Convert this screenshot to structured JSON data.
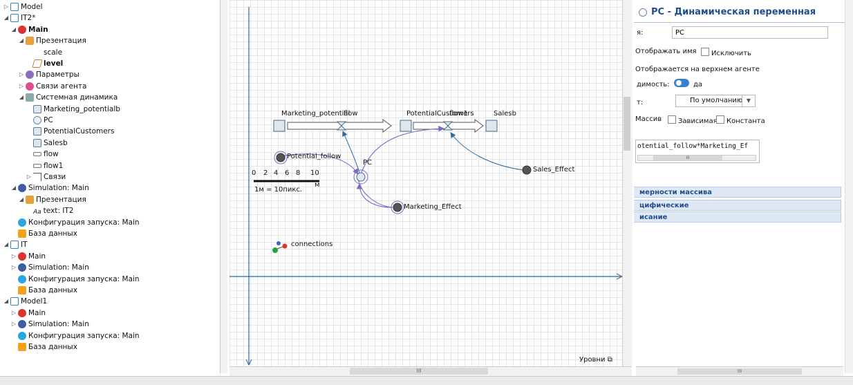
{
  "tree": [
    {
      "label": "Model",
      "icon": "model-icon",
      "level": 0,
      "twisty": "▷",
      "bold": false
    },
    {
      "label": "IT2*",
      "icon": "model-icon",
      "level": 0,
      "twisty": "◢",
      "bold": false
    },
    {
      "label": "Main",
      "icon": "agent-icon",
      "level": 1,
      "twisty": "◢",
      "bold": true
    },
    {
      "label": "Презентация",
      "icon": "presentation-icon",
      "level": 2,
      "twisty": "◢",
      "bold": false
    },
    {
      "label": "scale",
      "icon": "scale-icon",
      "level": 3,
      "twisty": "",
      "bold": false
    },
    {
      "label": "level",
      "icon": "level-icon",
      "level": 3,
      "twisty": "",
      "bold": true
    },
    {
      "label": "Параметры",
      "icon": "parameters-icon",
      "level": 2,
      "twisty": "▷",
      "bold": false
    },
    {
      "label": "Связи агента",
      "icon": "agent-links-icon",
      "level": 2,
      "twisty": "▷",
      "bold": false
    },
    {
      "label": "Системная динамика",
      "icon": "system-dynamics-icon",
      "level": 2,
      "twisty": "◢",
      "bold": false
    },
    {
      "label": "Marketing_potentialb",
      "icon": "stock-icon",
      "level": 3,
      "twisty": "",
      "bold": false
    },
    {
      "label": "PC",
      "icon": "dynamic-variable-icon",
      "level": 3,
      "twisty": "",
      "bold": false
    },
    {
      "label": "PotentialCustomers",
      "icon": "stock-icon",
      "level": 3,
      "twisty": "",
      "bold": false
    },
    {
      "label": "Salesb",
      "icon": "stock-icon",
      "level": 3,
      "twisty": "",
      "bold": false
    },
    {
      "label": "flow",
      "icon": "flow-icon",
      "level": 3,
      "twisty": "",
      "bold": false
    },
    {
      "label": "flow1",
      "icon": "flow-icon",
      "level": 3,
      "twisty": "",
      "bold": false
    },
    {
      "label": "Связи",
      "icon": "connections-icon",
      "level": 3,
      "twisty": "▷",
      "bold": false
    },
    {
      "label": "Simulation: Main",
      "icon": "simulation-icon",
      "level": 1,
      "twisty": "◢",
      "bold": false
    },
    {
      "label": "Презентация",
      "icon": "presentation-icon",
      "level": 2,
      "twisty": "◢",
      "bold": false
    },
    {
      "label": "text: IT2",
      "icon": "text-icon",
      "level": 3,
      "twisty": "",
      "bold": false
    },
    {
      "label": "Конфигурация запуска: Main",
      "icon": "run-config-icon",
      "level": 1,
      "twisty": "",
      "bold": false
    },
    {
      "label": "База данных",
      "icon": "database-icon",
      "level": 1,
      "twisty": "",
      "bold": false
    },
    {
      "label": "IT",
      "icon": "model-icon",
      "level": 0,
      "twisty": "◢",
      "bold": false
    },
    {
      "label": "Main",
      "icon": "agent-icon",
      "level": 1,
      "twisty": "▷",
      "bold": false
    },
    {
      "label": "Simulation: Main",
      "icon": "simulation-icon",
      "level": 1,
      "twisty": "▷",
      "bold": false
    },
    {
      "label": "Конфигурация запуска: Main",
      "icon": "run-config-icon",
      "level": 1,
      "twisty": "",
      "bold": false
    },
    {
      "label": "База данных",
      "icon": "database-icon",
      "level": 1,
      "twisty": "",
      "bold": false
    },
    {
      "label": "Model1",
      "icon": "model-icon",
      "level": 0,
      "twisty": "◢",
      "bold": false
    },
    {
      "label": "Main",
      "icon": "agent-icon",
      "level": 1,
      "twisty": "▷",
      "bold": false
    },
    {
      "label": "Simulation: Main",
      "icon": "simulation-icon",
      "level": 1,
      "twisty": "▷",
      "bold": false
    },
    {
      "label": "Конфигурация запуска: Main",
      "icon": "run-config-icon",
      "level": 1,
      "twisty": "",
      "bold": false
    },
    {
      "label": "База данных",
      "icon": "database-icon",
      "level": 1,
      "twisty": "",
      "bold": false
    }
  ],
  "text_glyph": "Aa",
  "canvas": {
    "labels": {
      "marketing_potential": "Marketing_potential",
      "flow": "flow",
      "potential_customers": "PotentialCustomers",
      "flow1": "flow1",
      "salesb": "Salesb",
      "potential_follow": "Potential_follow",
      "pc": "PC",
      "sales_effect": "Sales_Effect",
      "marketing_effect": "Marketing_Effect",
      "connections": "connections"
    },
    "scale": {
      "ticks": [
        "0",
        "2",
        "4",
        "6",
        "8",
        "10"
      ],
      "unit": "м",
      "caption": "1м = 10пикс."
    },
    "levels_label": "Уровни",
    "hscroll_glyph": "III"
  },
  "props": {
    "title": "PC - Динамическая переменная",
    "name_label": "я:",
    "name_value": "PC",
    "show_name": "Отображать имя",
    "exclude": "Исключить",
    "shown_on_top": "Отображается на верхнем агенте",
    "visibility_label": "димость:",
    "visibility_value": "да",
    "type_label": "т:",
    "type_value": "По умолчанию",
    "array": "Массив",
    "dependent": "Зависимая",
    "constant": "Константа",
    "formula": "otential_follow*Marketing_Ef",
    "formula_scroll": "III",
    "sections": [
      "мерности массива",
      "цифические",
      "исание"
    ],
    "hscroll_glyph": "III"
  },
  "colors": {
    "accent": "#1f4e8c",
    "canvas_line": "#2c6aa0",
    "connector": "#7a6cc4",
    "stock_fill": "#dfe6ee",
    "stock_border": "#4d6b87"
  }
}
